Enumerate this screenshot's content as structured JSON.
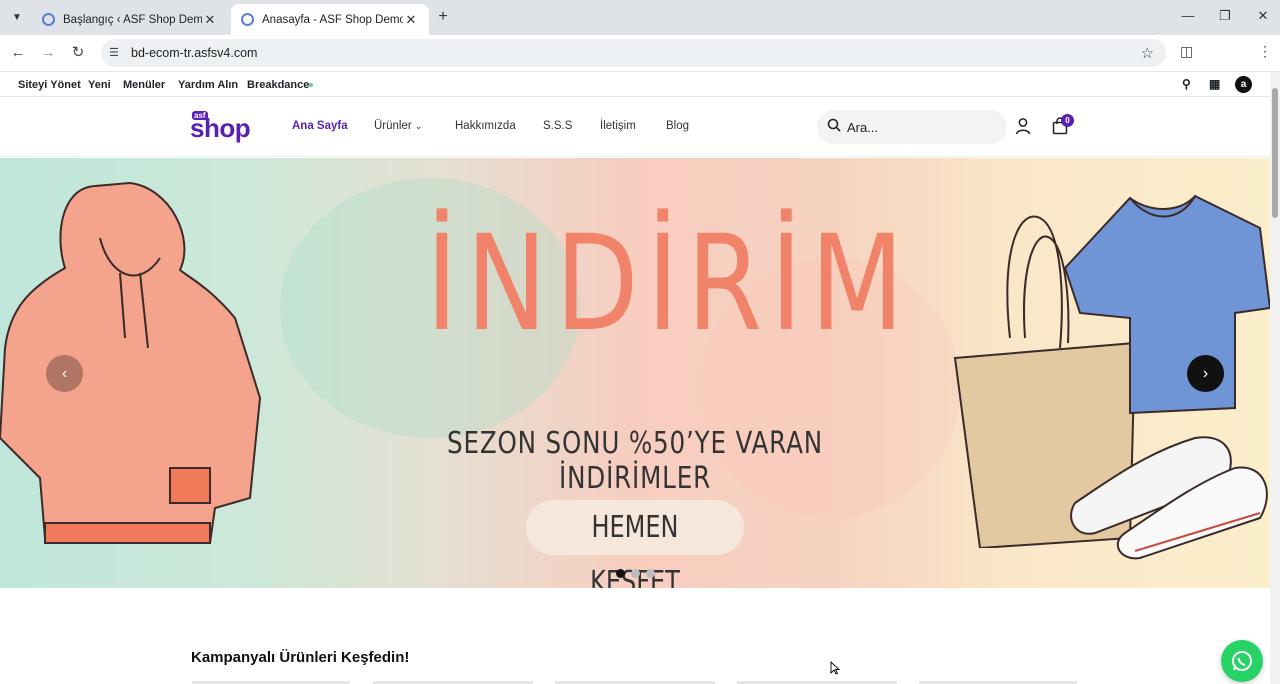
{
  "browser": {
    "tabs": [
      {
        "title": "Başlangıç ‹ ASF Shop Demo — W"
      },
      {
        "title": "Anasayfa - ASF Shop Demo"
      }
    ],
    "url": "bd-ecom-tr.asfsv4.com"
  },
  "adminbar": {
    "items": [
      "Siteyi Yönet",
      "Yeni",
      "Menüler",
      "Yardım Alın",
      "Breakdance"
    ],
    "avatar_letter": "a"
  },
  "header": {
    "logo_small": "asf",
    "logo_big": "shop",
    "nav": [
      "Ana Sayfa",
      "Ürünler",
      "Hakkımızda",
      "S.S.S",
      "İletişim",
      "Blog"
    ],
    "search_placeholder": "Ara...",
    "cart_count": "0"
  },
  "hero": {
    "title": "İNDİRİM",
    "subtitle": "SEZON SONU %50’YE VARAN İNDİRİMLER",
    "cta": "HEMEN KEŞFET",
    "active_slide": 1,
    "slide_count": 3
  },
  "section": {
    "title": "Kampanyalı Ürünleri Keşfedin!"
  },
  "colors": {
    "brand": "#5a1fb5",
    "hero_text": "#f0836a",
    "whatsapp": "#25d366"
  }
}
